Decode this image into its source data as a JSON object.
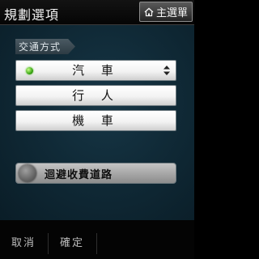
{
  "header": {
    "title": "規劃選項",
    "home_button_label": "主選單",
    "home_icon": "home-icon"
  },
  "section": {
    "label": "交通方式"
  },
  "transport_options": [
    {
      "label": "汽 車",
      "selected": true
    },
    {
      "label": "行 人",
      "selected": false
    },
    {
      "label": "機 車",
      "selected": false
    }
  ],
  "avoid_toll": {
    "label": "迴避收費道路",
    "enabled": false
  },
  "softkeys": {
    "left": "取消",
    "right": "確定"
  },
  "colors": {
    "background": "#102a37",
    "selected_indicator": "#39a514"
  }
}
